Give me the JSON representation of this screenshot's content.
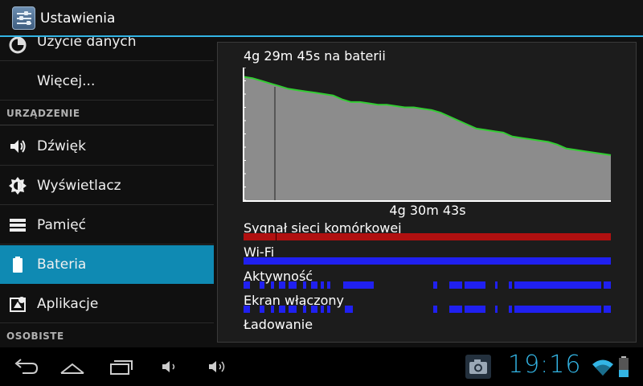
{
  "action_bar": {
    "title": "Ustawienia",
    "icon": "settings-sliders-icon"
  },
  "sidebar": {
    "items": [
      {
        "label": "Użycie danych",
        "icon": "data-usage-icon"
      },
      {
        "label": "Więcej...",
        "icon": ""
      },
      {
        "header": "URZĄDZENIE"
      },
      {
        "label": "Dźwięk",
        "icon": "speaker-icon"
      },
      {
        "label": "Wyświetlacz",
        "icon": "brightness-icon"
      },
      {
        "label": "Pamięć",
        "icon": "storage-icon"
      },
      {
        "label": "Bateria",
        "icon": "battery-icon",
        "selected": true
      },
      {
        "label": "Aplikacje",
        "icon": "apps-icon"
      },
      {
        "header": "OSOBISTE"
      }
    ]
  },
  "battery": {
    "summary": "4g 29m 45s na baterii",
    "duration": "4g 30m 43s",
    "graph": {
      "fill_color": "#8c8c8c",
      "line_color": "#33cc33",
      "levels": [
        0.93,
        0.92,
        0.9,
        0.88,
        0.86,
        0.84,
        0.83,
        0.82,
        0.81,
        0.8,
        0.79,
        0.76,
        0.74,
        0.74,
        0.73,
        0.72,
        0.72,
        0.71,
        0.7,
        0.7,
        0.69,
        0.68,
        0.66,
        0.63,
        0.6,
        0.57,
        0.54,
        0.53,
        0.52,
        0.51,
        0.48,
        0.47,
        0.46,
        0.45,
        0.44,
        0.42,
        0.39,
        0.38,
        0.37,
        0.36,
        0.35,
        0.34
      ]
    },
    "tracks": [
      {
        "label": "Sygnał sieci komórkowej",
        "color": "#b01010"
      },
      {
        "label": "Wi-Fi",
        "color": "#2020f0"
      },
      {
        "label": "Aktywność",
        "color": "#2020f0"
      },
      {
        "label": "Ekran włączony",
        "color": "#2020f0"
      },
      {
        "label": "Ładowanie",
        "color": ""
      }
    ]
  },
  "system_bar": {
    "clock": "19:16",
    "accent_color": "#33b5e5",
    "nav": [
      "back-icon",
      "home-icon",
      "recent-apps-icon",
      "volume-down-icon",
      "volume-up-icon"
    ]
  }
}
